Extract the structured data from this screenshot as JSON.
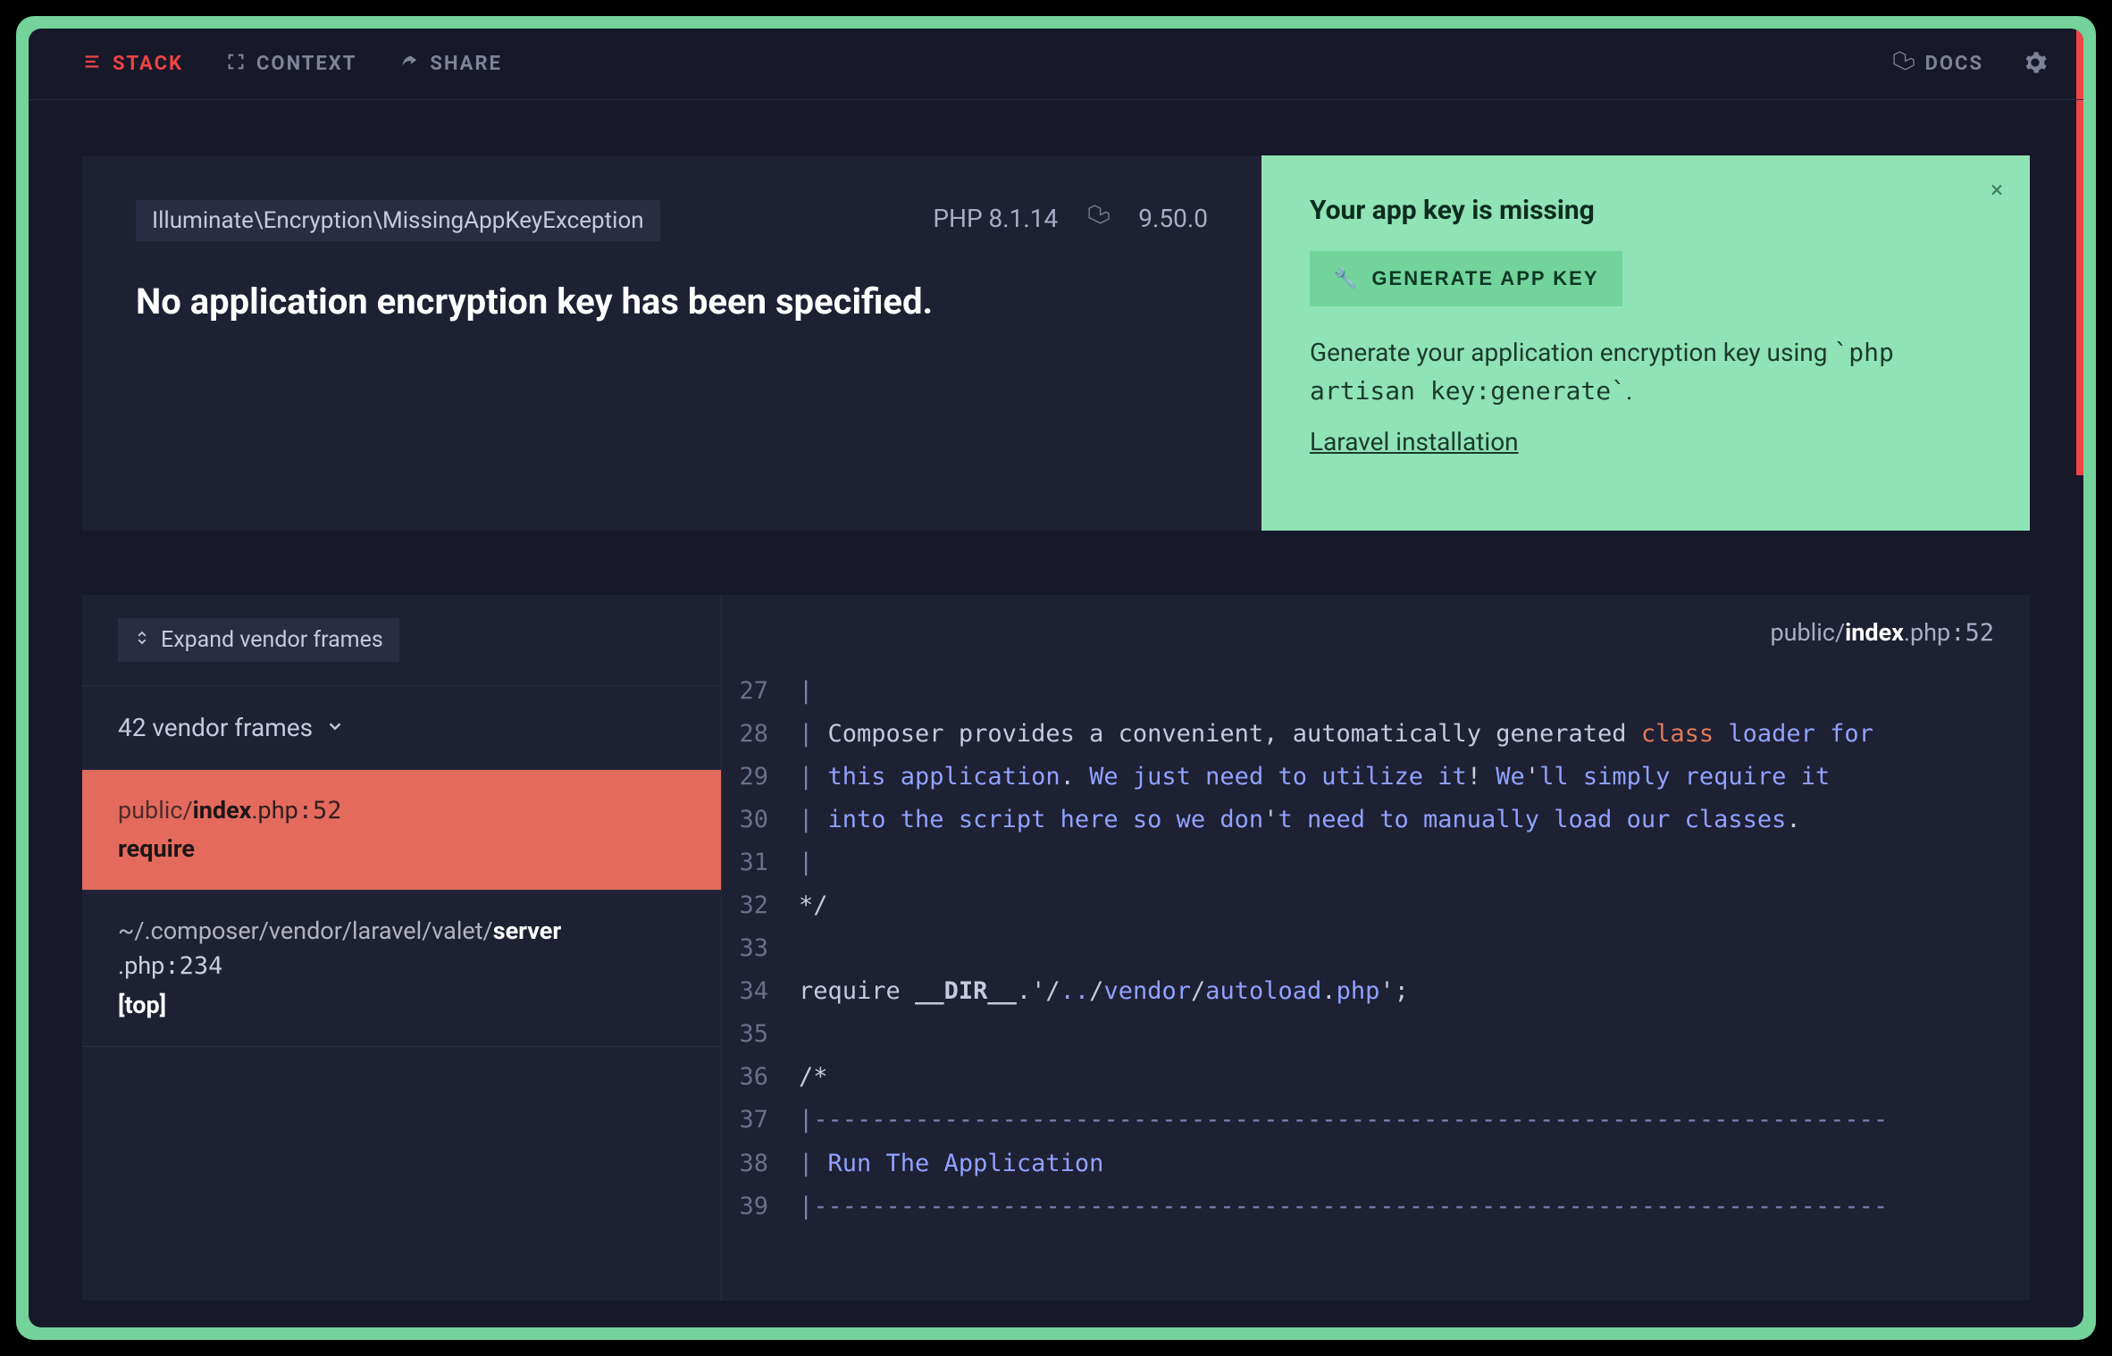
{
  "nav": {
    "stack": "STACK",
    "context": "CONTEXT",
    "share": "SHARE",
    "docs": "DOCS"
  },
  "exception": {
    "class": "Illuminate\\Encryption\\MissingAppKeyException",
    "php_label": "PHP 8.1.14",
    "laravel_version": "9.50.0",
    "message": "No application encryption key has been specified."
  },
  "solution": {
    "title": "Your app key is missing",
    "button": "GENERATE APP KEY",
    "desc_prefix": "Generate your application encryption key using ",
    "desc_code": "`php artisan key:generate`",
    "desc_suffix": ".",
    "link": "Laravel installation"
  },
  "frames": {
    "expand_label": "Expand vendor frames",
    "vendor_summary": "42 vendor frames",
    "active": {
      "dir": "public/",
      "file": "index",
      "ext": ".php",
      "line": ":52",
      "fn": "require"
    },
    "second": {
      "dir": "~/.composer/vendor/laravel/valet/",
      "file": "server",
      "ext": ".php",
      "line": ":234",
      "tag": "[top]"
    }
  },
  "code_header": {
    "dir": "public/",
    "file": "index",
    "ext": ".php",
    "line": ":52"
  },
  "code": {
    "start": 27,
    "lines": [
      {
        "n": 27,
        "seg": [
          {
            "t": "|",
            "c": "tok-sep"
          }
        ]
      },
      {
        "n": 28,
        "seg": [
          {
            "t": "| ",
            "c": "tok-sep"
          },
          {
            "t": "Composer provides a convenient, automatically generated ",
            "c": "tok-comment"
          },
          {
            "t": "class",
            "c": "tok-kw"
          },
          {
            "t": " ",
            "c": "tok-comment"
          },
          {
            "t": "loader for",
            "c": "tok-self"
          }
        ]
      },
      {
        "n": 29,
        "seg": [
          {
            "t": "| ",
            "c": "tok-sep"
          },
          {
            "t": "this application",
            "c": "tok-self"
          },
          {
            "t": ".",
            "c": "tok-comment"
          },
          {
            "t": " We just need to utilize it",
            "c": "tok-self"
          },
          {
            "t": "!",
            "c": "tok-comment"
          },
          {
            "t": " We",
            "c": "tok-self"
          },
          {
            "t": "'",
            "c": "tok-comment"
          },
          {
            "t": "ll simply require it",
            "c": "tok-self"
          }
        ]
      },
      {
        "n": 30,
        "seg": [
          {
            "t": "| ",
            "c": "tok-sep"
          },
          {
            "t": "into the script here so we don",
            "c": "tok-self"
          },
          {
            "t": "'",
            "c": "tok-comment"
          },
          {
            "t": "t need to manually load our classes",
            "c": "tok-self"
          },
          {
            "t": ".",
            "c": "tok-comment"
          }
        ]
      },
      {
        "n": 31,
        "seg": [
          {
            "t": "|",
            "c": "tok-sep"
          }
        ]
      },
      {
        "n": 32,
        "seg": [
          {
            "t": "*/",
            "c": "tok-comment"
          }
        ]
      },
      {
        "n": 33,
        "seg": [
          {
            "t": "",
            "c": ""
          }
        ]
      },
      {
        "n": 34,
        "seg": [
          {
            "t": "require",
            "c": "reqfn"
          },
          {
            "t": " ",
            "c": ""
          },
          {
            "t": "__DIR__",
            "c": "mag"
          },
          {
            "t": ".",
            "c": "tok-comment"
          },
          {
            "t": "'",
            "c": "tok-comment"
          },
          {
            "t": "/",
            "c": "tok-comment"
          },
          {
            "t": "..",
            "c": "tok-pale"
          },
          {
            "t": "/",
            "c": "tok-comment"
          },
          {
            "t": "vendor",
            "c": "tok-self"
          },
          {
            "t": "/",
            "c": "tok-comment"
          },
          {
            "t": "autoload",
            "c": "tok-self"
          },
          {
            "t": ".",
            "c": "tok-comment"
          },
          {
            "t": "php",
            "c": "tok-self"
          },
          {
            "t": "'",
            "c": "tok-comment"
          },
          {
            "t": ";",
            "c": "tok-comment"
          }
        ]
      },
      {
        "n": 35,
        "seg": [
          {
            "t": "",
            "c": ""
          }
        ]
      },
      {
        "n": 36,
        "seg": [
          {
            "t": "/*",
            "c": "tok-comment"
          }
        ]
      },
      {
        "n": 37,
        "seg": [
          {
            "t": "|--------------------------------------------------------------------------",
            "c": "tok-sep"
          }
        ]
      },
      {
        "n": 38,
        "seg": [
          {
            "t": "| ",
            "c": "tok-sep"
          },
          {
            "t": "Run The Application",
            "c": "tok-self"
          }
        ]
      },
      {
        "n": 39,
        "seg": [
          {
            "t": "|--------------------------------------------------------------------------",
            "c": "tok-sep"
          }
        ]
      }
    ]
  }
}
